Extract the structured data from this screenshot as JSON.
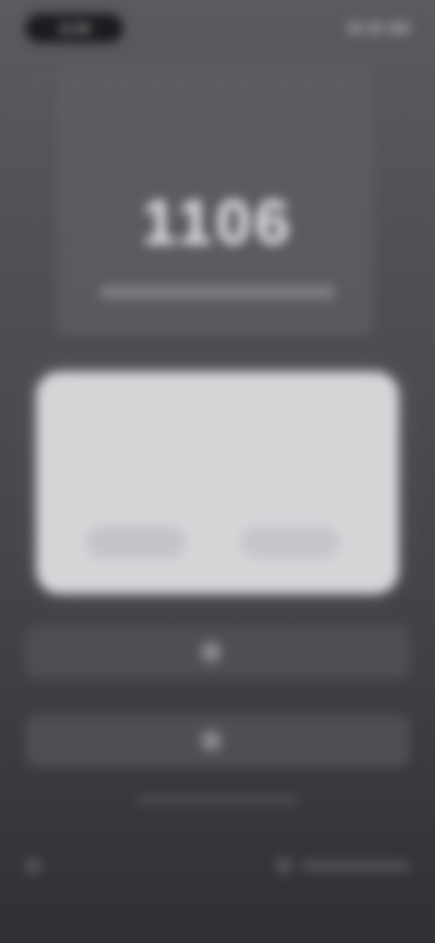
{
  "status_bar": {
    "time": "11:06"
  },
  "header": {
    "back_icon": "chevron-left-icon"
  },
  "balance": {
    "amount": "1106"
  },
  "dialog": {
    "title": "",
    "message": "",
    "cancel_label": "",
    "confirm_label": ""
  },
  "actions": [
    {
      "icon": "action-icon",
      "label": ""
    },
    {
      "icon": "action-icon",
      "label": ""
    }
  ],
  "footer": {
    "left_label": "",
    "right_label": ""
  },
  "colors": {
    "background_top": "#5a5b60",
    "background_bottom": "#2f3035",
    "dialog_bg": "#d6d6d9",
    "text_light": "#e8e8ea"
  }
}
